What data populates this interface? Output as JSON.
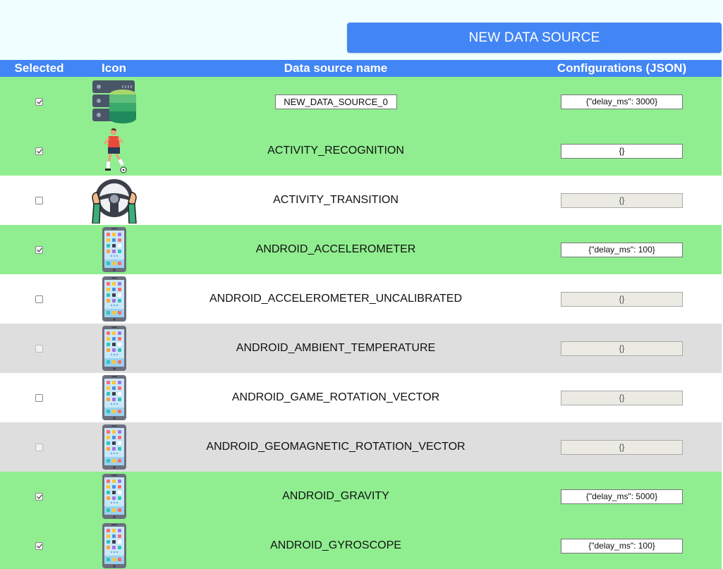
{
  "toolbar": {
    "new_button_label": "NEW DATA SOURCE"
  },
  "columns": {
    "selected": "Selected",
    "icon": "Icon",
    "name": "Data source name",
    "config": "Configurations (JSON)"
  },
  "colors": {
    "accent": "#4285f4",
    "row_selected": "#90ee90",
    "row_white": "#ffffff",
    "row_grey": "#dedede",
    "page_bg": "#f0ffff"
  },
  "rows": [
    {
      "selected": true,
      "icon": "database-icon",
      "name": "NEW_DATA_SOURCE_0",
      "name_editable": true,
      "config": "{\"delay_ms\": 3000}",
      "config_enabled": true,
      "row_style": "green"
    },
    {
      "selected": true,
      "icon": "soccer-player-icon",
      "name": "ACTIVITY_RECOGNITION",
      "name_editable": false,
      "config": "{}",
      "config_enabled": true,
      "row_style": "green"
    },
    {
      "selected": false,
      "icon": "steering-wheel-icon",
      "name": "ACTIVITY_TRANSITION",
      "name_editable": false,
      "config": "{}",
      "config_enabled": false,
      "row_style": "white"
    },
    {
      "selected": true,
      "icon": "smartphone-icon",
      "name": "ANDROID_ACCELEROMETER",
      "name_editable": false,
      "config": "{\"delay_ms\": 100}",
      "config_enabled": true,
      "row_style": "green"
    },
    {
      "selected": false,
      "icon": "smartphone-icon",
      "name": "ANDROID_ACCELEROMETER_UNCALIBRATED",
      "name_editable": false,
      "config": "{}",
      "config_enabled": false,
      "row_style": "white"
    },
    {
      "selected": false,
      "icon": "smartphone-icon",
      "name": "ANDROID_AMBIENT_TEMPERATURE",
      "name_editable": false,
      "config": "{}",
      "config_enabled": false,
      "row_style": "grey",
      "checkbox_disabled": true
    },
    {
      "selected": false,
      "icon": "smartphone-icon",
      "name": "ANDROID_GAME_ROTATION_VECTOR",
      "name_editable": false,
      "config": "{}",
      "config_enabled": false,
      "row_style": "white"
    },
    {
      "selected": false,
      "icon": "smartphone-icon",
      "name": "ANDROID_GEOMAGNETIC_ROTATION_VECTOR",
      "name_editable": false,
      "config": "{}",
      "config_enabled": false,
      "row_style": "grey",
      "checkbox_disabled": true
    },
    {
      "selected": true,
      "icon": "smartphone-icon",
      "name": "ANDROID_GRAVITY",
      "name_editable": false,
      "config": "{\"delay_ms\": 5000}",
      "config_enabled": true,
      "row_style": "green"
    },
    {
      "selected": true,
      "icon": "smartphone-icon",
      "name": "ANDROID_GYROSCOPE",
      "name_editable": false,
      "config": "{\"delay_ms\": 100}",
      "config_enabled": true,
      "row_style": "green"
    }
  ]
}
